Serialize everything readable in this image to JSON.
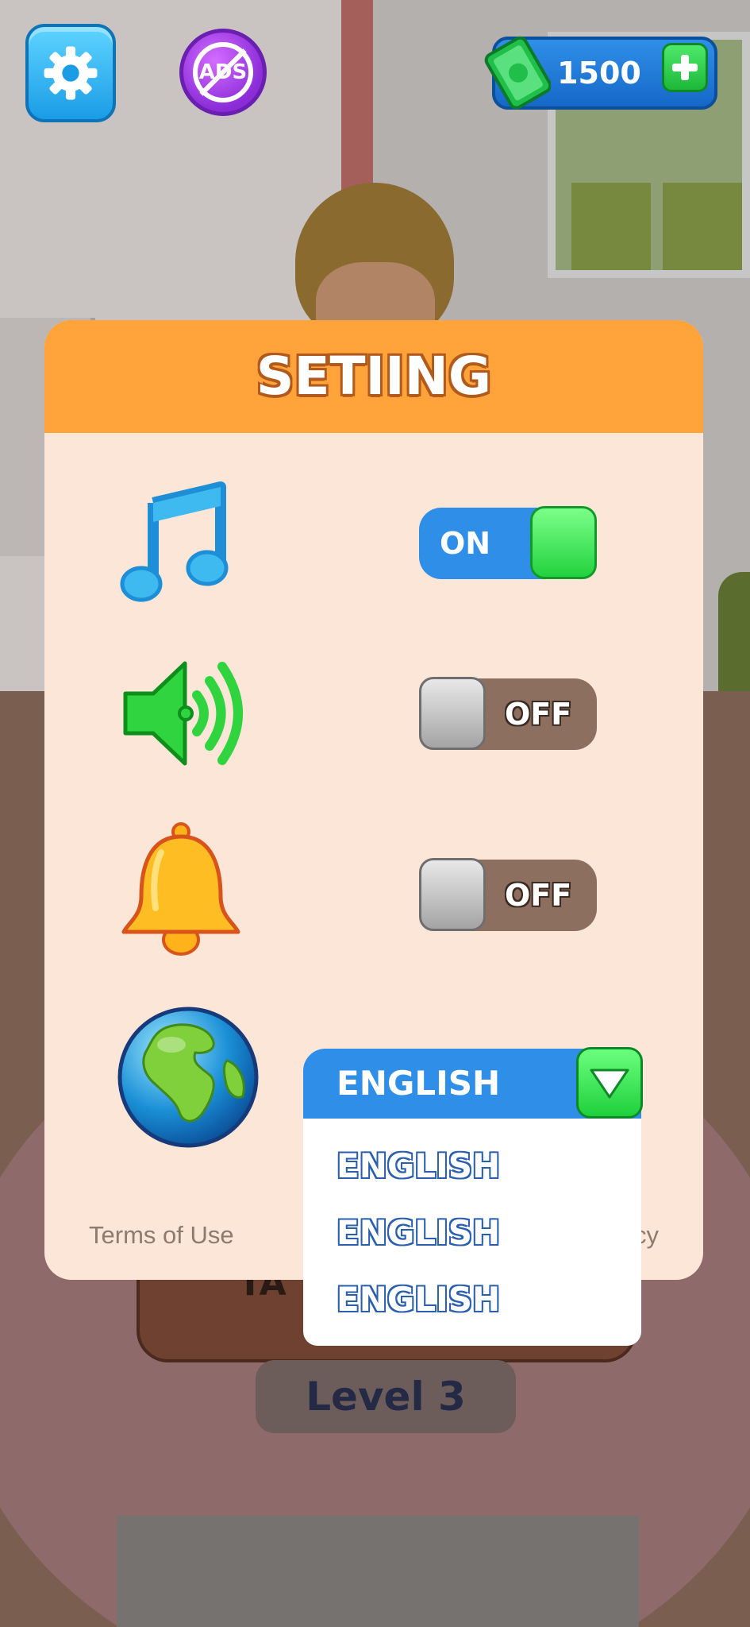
{
  "hud": {
    "settings_icon": "gear-icon",
    "noads_label": "ADS",
    "cash_value": "1500",
    "cash_icon": "cash-icon",
    "add_icon": "plus-icon"
  },
  "background": {
    "level_label": "Level 3",
    "table_label": "TA"
  },
  "settings": {
    "title": "SETIING",
    "music": {
      "icon": "music-note-icon",
      "state_label": "ON"
    },
    "sound": {
      "icon": "speaker-icon",
      "state_label": "OFF"
    },
    "notifications": {
      "icon": "bell-icon",
      "state_label": "OFF"
    },
    "language": {
      "icon": "globe-icon",
      "selected": "ENGLISH",
      "options": [
        "ENGLISH",
        "ENGLISH",
        "ENGLISH"
      ]
    },
    "terms_label": "Terms of Use",
    "privacy_label_visible": "cy"
  },
  "colors": {
    "header_orange": "#ffa33a",
    "panel_bg": "#fbe6d8",
    "toggle_on_blue": "#2f8fe8",
    "toggle_off_brown": "#8c6f5f",
    "knob_green": "#22d23e"
  }
}
